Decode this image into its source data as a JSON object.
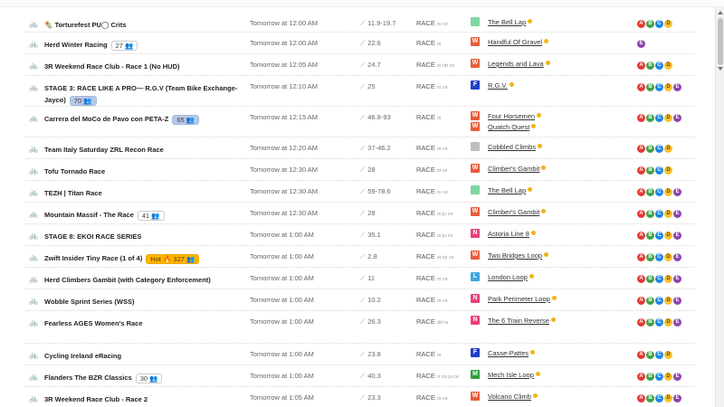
{
  "rows": [
    {
      "name": "Torturefest PU◯ Crits",
      "emoji": "🌯",
      "count": "",
      "count_style": "",
      "time": "Tomorrow at 12:00 AM",
      "distance": "11.9-19.7",
      "type": "RACE",
      "flags": "rs ce",
      "worlds": [
        {
          "badge": "",
          "color": "#7ed6a0",
          "label": "The Bell Lap"
        }
      ],
      "cats": [
        "A",
        "B",
        "C",
        "D"
      ]
    },
    {
      "name": "Herd Winter Racing",
      "emoji": "",
      "count": "27 👥",
      "count_style": "",
      "time": "Tomorrow at 12:00 AM",
      "distance": "22.6",
      "type": "RACE",
      "flags": "rs",
      "worlds": [
        {
          "badge": "W",
          "color": "#e85c3a",
          "label": "Handful Of Gravel"
        }
      ],
      "cats": [
        "E"
      ]
    },
    {
      "name": "3R Weekend Race Club - Race 1 (No HUD)",
      "emoji": "",
      "count": "",
      "count_style": "",
      "time": "Tomorrow at 12:05 AM",
      "distance": "24.7",
      "type": "RACE",
      "flags": "rs nh ce",
      "worlds": [
        {
          "badge": "W",
          "color": "#e85c3a",
          "label": "Legends and Lava"
        }
      ],
      "cats": [
        "A",
        "B",
        "C",
        "D"
      ]
    },
    {
      "name": "STAGE 3: RACE LIKE A PRO— R.G.V (Team Bike Exchange-Jayco)",
      "emoji": "",
      "count": "70 👥",
      "count_style": "blue",
      "time": "Tomorrow at 12:10 AM",
      "distance": "25",
      "type": "RACE",
      "flags": "rs ce",
      "worlds": [
        {
          "badge": "F",
          "color": "#1e3fc8",
          "label": "R.G.V."
        }
      ],
      "cats": [
        "A",
        "B",
        "C",
        "D",
        "E"
      ]
    },
    {
      "name": "Carrera del MoCo de Pavo con PETA-Z",
      "emoji": "",
      "count": "65 👥",
      "count_style": "blue",
      "time": "Tomorrow at 12:15 AM",
      "distance": "46.8-93",
      "type": "RACE",
      "flags": "rs",
      "worlds": [
        {
          "badge": "W",
          "color": "#e85c3a",
          "label": "Four Horsemen"
        },
        {
          "badge": "W",
          "color": "#e85c3a",
          "label": "Quatch Quest"
        }
      ],
      "cats": [
        "A",
        "B",
        "C",
        "D",
        "E"
      ]
    },
    {
      "name": "Team Italy Saturday ZRL Recon Race",
      "emoji": "",
      "count": "",
      "count_style": "",
      "time": "Tomorrow at 12:20 AM",
      "distance": "37-46.2",
      "type": "RACE",
      "flags": "rs ce",
      "worlds": [
        {
          "badge": "",
          "color": "#bdbdbd",
          "label": "Cobbled Climbs"
        }
      ],
      "cats": [
        "A",
        "B",
        "C",
        "D"
      ]
    },
    {
      "name": "Tofu Tornado Race",
      "emoji": "",
      "count": "",
      "count_style": "",
      "time": "Tomorrow at 12:30 AM",
      "distance": "28",
      "type": "RACE",
      "flags": "st ce",
      "worlds": [
        {
          "badge": "W",
          "color": "#e85c3a",
          "label": "Climber's Gambit"
        }
      ],
      "cats": [
        "A",
        "B",
        "C",
        "D"
      ]
    },
    {
      "name": "TEZH | Titan Race",
      "emoji": "",
      "count": "",
      "count_style": "",
      "time": "Tomorrow at 12:30 AM",
      "distance": "59-78.6",
      "type": "RACE",
      "flags": "rs ce",
      "worlds": [
        {
          "badge": "",
          "color": "#7ed6a0",
          "label": "The Bell Lap"
        }
      ],
      "cats": [
        "A",
        "B",
        "C",
        "D",
        "E"
      ]
    },
    {
      "name": "Mountain Massif - The Race",
      "emoji": "",
      "count": "41 👥",
      "count_style": "",
      "time": "Tomorrow at 12:30 AM",
      "distance": "28",
      "type": "RACE",
      "flags": "rs ju ce",
      "worlds": [
        {
          "badge": "W",
          "color": "#e85c3a",
          "label": "Climber's Gambit"
        }
      ],
      "cats": [
        "A",
        "B",
        "C",
        "D",
        "E"
      ]
    },
    {
      "name": "STAGE 8: EKOI RACE SERIES",
      "emoji": "",
      "count": "",
      "count_style": "",
      "time": "Tomorrow at 1:00 AM",
      "distance": "35.1",
      "type": "RACE",
      "flags": "rs ju ce",
      "worlds": [
        {
          "badge": "N",
          "color": "#e8407a",
          "label": "Astoria Line 8"
        }
      ],
      "cats": [
        "A",
        "B",
        "C",
        "D",
        "E"
      ]
    },
    {
      "name": "Zwift Insider Tiny Race (1 of 4)",
      "emoji": "",
      "count": "Hot 🔥 327 👥",
      "count_style": "hot",
      "time": "Tomorrow at 1:00 AM",
      "distance": "2.8",
      "type": "RACE",
      "flags": "st cp ce",
      "worlds": [
        {
          "badge": "W",
          "color": "#e85c3a",
          "label": "Two Bridges Loop"
        }
      ],
      "cats": [
        "A",
        "B",
        "C",
        "D",
        "E"
      ]
    },
    {
      "name": "Herd Climbers Gambit (with Category Enforcement)",
      "emoji": "",
      "count": "",
      "count_style": "",
      "time": "Tomorrow at 1:00 AM",
      "distance": "11",
      "type": "RACE",
      "flags": "rs ce",
      "worlds": [
        {
          "badge": "L",
          "color": "#3aa8e0",
          "label": "London Loop"
        }
      ],
      "cats": [
        "A",
        "B",
        "C",
        "D",
        "E"
      ]
    },
    {
      "name": "Wobble Sprint Series (WSS)",
      "emoji": "",
      "count": "",
      "count_style": "",
      "time": "Tomorrow at 1:00 AM",
      "distance": "10.2",
      "type": "RACE",
      "flags": "rs ce",
      "worlds": [
        {
          "badge": "N",
          "color": "#e8407a",
          "label": "Park Perimeter Loop"
        }
      ],
      "cats": [
        "A",
        "B",
        "C",
        "D",
        "E"
      ]
    },
    {
      "name": "Fearless AGES Women's Race",
      "emoji": "",
      "count": "",
      "count_style": "",
      "time": "Tomorrow at 1:00 AM",
      "distance": "26.3",
      "type": "RACE",
      "flags": "dd rs",
      "worlds": [
        {
          "badge": "N",
          "color": "#e8407a",
          "label": "The 6 Train Reverse"
        }
      ],
      "cats": [
        "A",
        "B",
        "C",
        "D",
        "E"
      ]
    },
    {
      "name": "Cycling Ireland eRacing",
      "emoji": "",
      "count": "",
      "count_style": "",
      "time": "Tomorrow at 1:00 AM",
      "distance": "23.8",
      "type": "RACE",
      "flags": "rs",
      "worlds": [
        {
          "badge": "F",
          "color": "#1e3fc8",
          "label": "Casse-Pattes"
        }
      ],
      "cats": [
        "A",
        "B",
        "C",
        "D"
      ]
    },
    {
      "name": "Flanders The BZR Classics",
      "emoji": "",
      "count": "30 👥",
      "count_style": "",
      "time": "Tomorrow at 1:00 AM",
      "distance": "40.3",
      "type": "RACE",
      "flags": "rr ns ju ce",
      "worlds": [
        {
          "badge": "M",
          "color": "#2e9e3e",
          "label": "Mech Isle Loop"
        }
      ],
      "cats": [
        "A",
        "B",
        "C",
        "D",
        "E"
      ]
    },
    {
      "name": "3R Weekend Race Club - Race 2",
      "emoji": "",
      "count": "",
      "count_style": "",
      "time": "Tomorrow at 1:05 AM",
      "distance": "23.3",
      "type": "RACE",
      "flags": "rs ce",
      "worlds": [
        {
          "badge": "W",
          "color": "#e85c3a",
          "label": "Volcano Climb"
        }
      ],
      "cats": [
        "A",
        "B",
        "C",
        "D",
        "E"
      ]
    }
  ]
}
